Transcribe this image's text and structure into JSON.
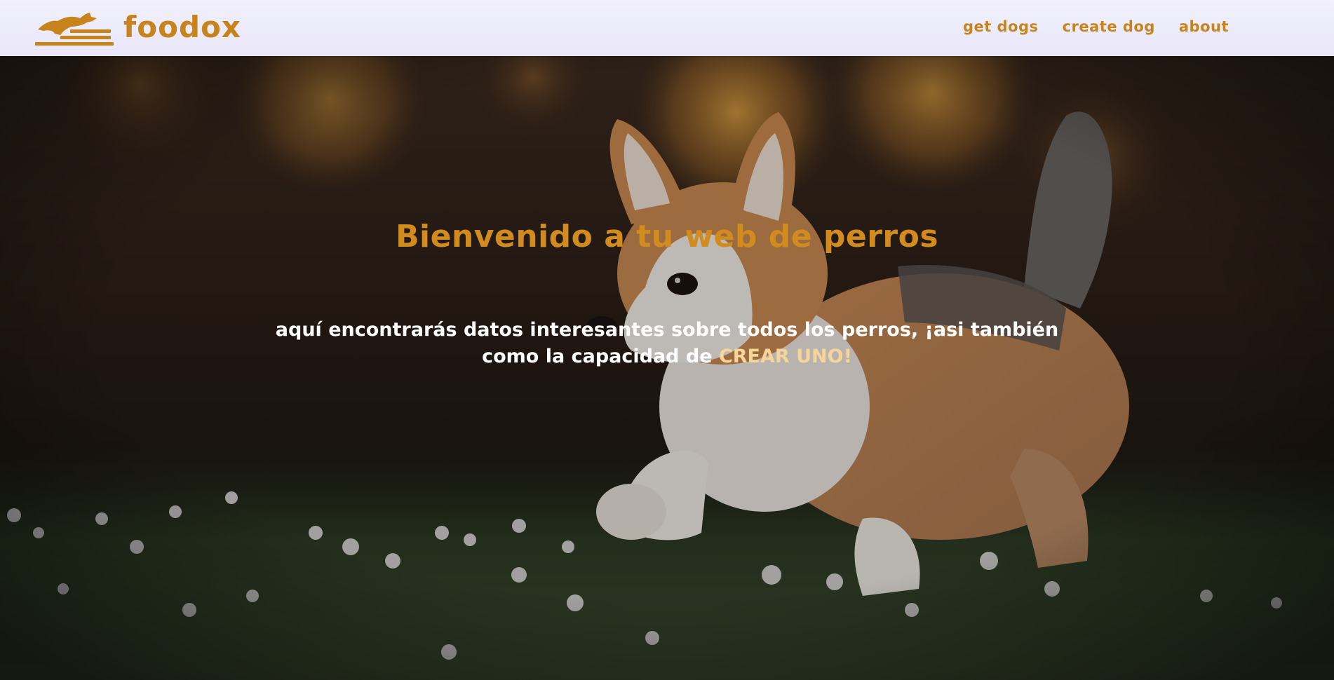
{
  "brand": {
    "name": "foodox",
    "logo_icon": "running-dog-logo-icon"
  },
  "nav": {
    "links": [
      {
        "label": "get dogs"
      },
      {
        "label": "create dog"
      },
      {
        "label": "about"
      }
    ]
  },
  "hero": {
    "title": "Bienvenido a tu web de perros",
    "text_before": "aquí encontrarás datos interesantes sobre todos los perros, ¡asi también como la capacidad de ",
    "cta": "CREAR UNO!",
    "background_image": "corgi-puppy-on-grass"
  },
  "colors": {
    "accent": "#c8841c",
    "nav_background": "#eeedfa",
    "cta_highlight": "#f6d59a"
  }
}
